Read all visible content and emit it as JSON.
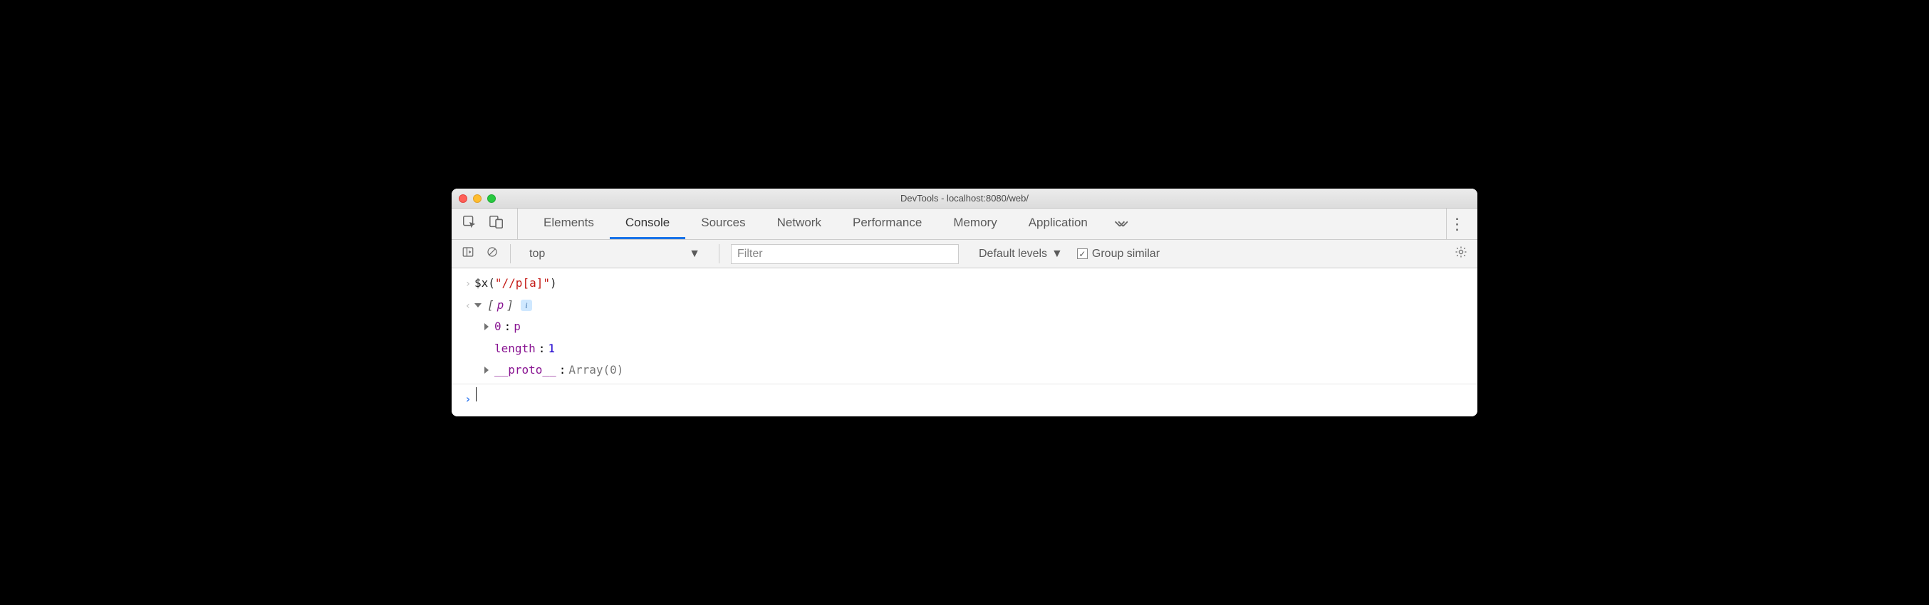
{
  "window": {
    "title": "DevTools - localhost:8080/web/"
  },
  "tabs": {
    "items": [
      "Elements",
      "Console",
      "Sources",
      "Network",
      "Performance",
      "Memory",
      "Application"
    ],
    "active_index": 1
  },
  "subbar": {
    "context": "top",
    "filter_placeholder": "Filter",
    "levels_label": "Default levels",
    "group_similar_label": "Group similar",
    "group_similar_checked": true
  },
  "console": {
    "input_expr": {
      "fn": "$x",
      "open": "(",
      "arg": "\"//p[a]\"",
      "close": ")"
    },
    "result": {
      "summary_open": "[",
      "summary_item": "p",
      "summary_close": "]",
      "lines": [
        {
          "disclosure": "closed",
          "key": "0",
          "sep": ": ",
          "val": "p",
          "val_class": "key-purple",
          "key_class": "key-purple"
        },
        {
          "disclosure": "none",
          "key": "length",
          "sep": ": ",
          "val": "1",
          "val_class": "val-blue",
          "key_class": "key-purple"
        },
        {
          "disclosure": "closed",
          "key": "__proto__",
          "sep": ": ",
          "val": "Array(0)",
          "val_class": "arr-text",
          "key_class": "key-purple"
        }
      ]
    }
  }
}
